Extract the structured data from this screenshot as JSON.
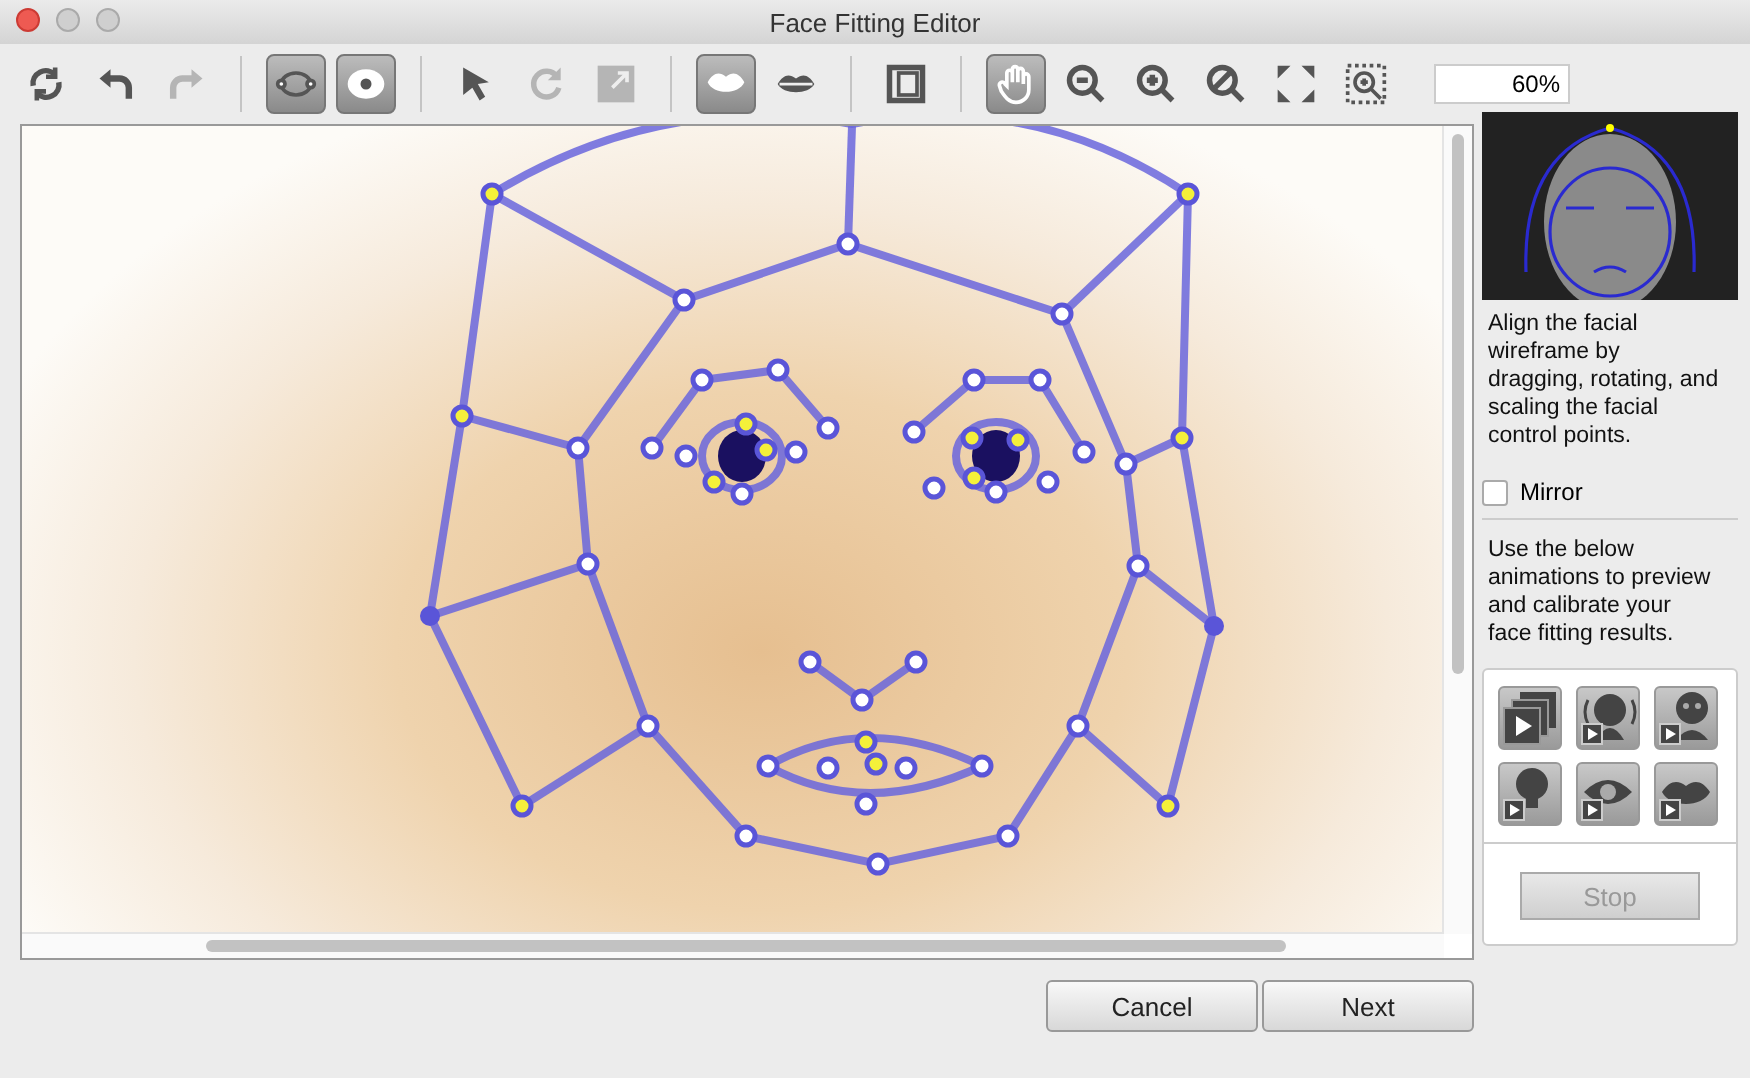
{
  "window": {
    "title": "Face Fitting Editor"
  },
  "toolbar": {
    "groups": [
      [
        {
          "kind": "sync",
          "selected": false,
          "disabled": false
        },
        {
          "kind": "undo",
          "selected": false,
          "disabled": false
        },
        {
          "kind": "redo",
          "selected": false,
          "disabled": true
        }
      ],
      [
        {
          "kind": "outline",
          "selected": true,
          "disabled": false
        },
        {
          "kind": "points",
          "selected": true,
          "disabled": false
        }
      ],
      [
        {
          "kind": "pointer",
          "selected": false,
          "disabled": false
        },
        {
          "kind": "rotate",
          "selected": false,
          "disabled": true
        },
        {
          "kind": "scale",
          "selected": false,
          "disabled": true
        }
      ],
      [
        {
          "kind": "lips-fill",
          "selected": true,
          "disabled": false
        },
        {
          "kind": "lips",
          "selected": false,
          "disabled": false
        }
      ],
      [
        {
          "kind": "frame",
          "selected": false,
          "disabled": false
        }
      ],
      [
        {
          "kind": "hand",
          "selected": true,
          "disabled": false
        },
        {
          "kind": "zoom-out",
          "selected": false,
          "disabled": false
        },
        {
          "kind": "zoom-in",
          "selected": false,
          "disabled": false
        },
        {
          "kind": "zoom-reset",
          "selected": false,
          "disabled": false
        },
        {
          "kind": "fit",
          "selected": false,
          "disabled": false
        },
        {
          "kind": "zoom-region",
          "selected": false,
          "disabled": false
        }
      ]
    ],
    "zoom": "60%"
  },
  "side": {
    "instructions": "Align the facial wireframe by dragging, rotating, and scaling the facial control points.",
    "mirror": {
      "label": "Mirror",
      "checked": false
    },
    "help": "Use the below animations to preview and calibrate your face fitting results.",
    "animations": [
      {
        "kind": "frames"
      },
      {
        "kind": "head-turn"
      },
      {
        "kind": "face"
      },
      {
        "kind": "head"
      },
      {
        "kind": "eye"
      },
      {
        "kind": "lips"
      }
    ],
    "stop": {
      "label": "Stop",
      "disabled": true
    }
  },
  "buttons": [
    "Cancel",
    "Next"
  ]
}
